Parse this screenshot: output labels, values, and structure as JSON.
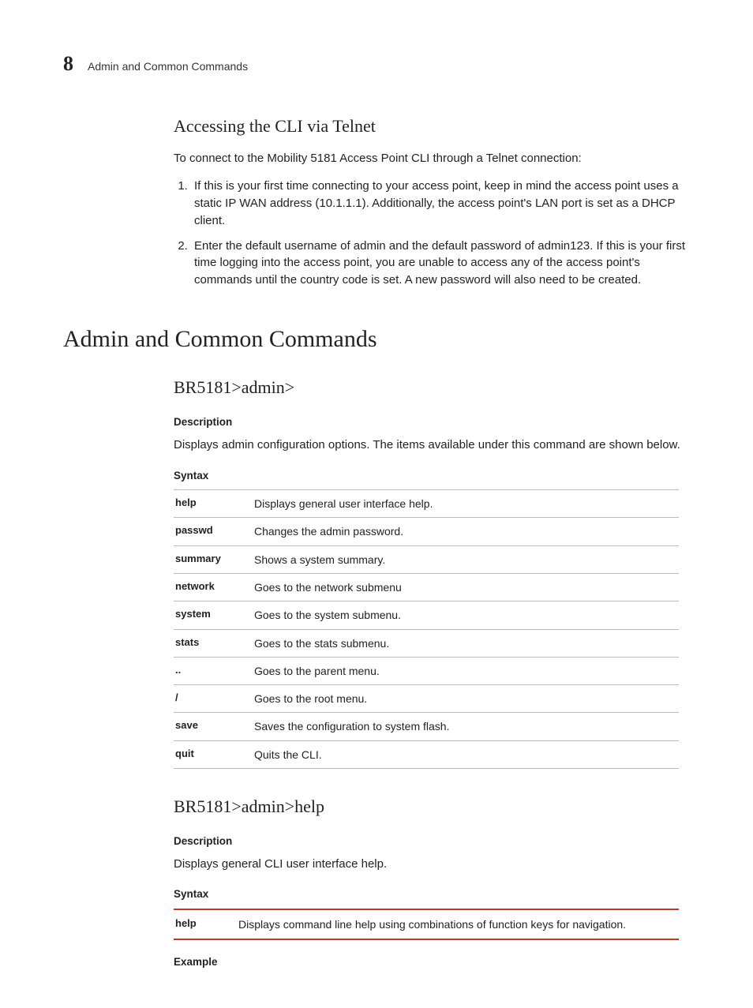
{
  "header": {
    "chapter_number": "8",
    "chapter_title": "Admin and Common Commands"
  },
  "section1": {
    "heading": "Accessing the CLI via Telnet",
    "intro": "To connect to the Mobility 5181 Access Point CLI through a Telnet connection:",
    "steps": [
      "If this is your first time connecting to your access point, keep in mind the access point uses a static IP WAN address (10.1.1.1). Additionally, the access point's LAN port is set as a DHCP client.",
      "Enter the default username of admin and the default password of admin123. If this is your first time logging into the access point, you are unable to access any of the access point's commands until the country code is set. A new password will also need to be created."
    ]
  },
  "h1": "Admin and Common Commands",
  "cmd1": {
    "heading": "BR5181>admin>",
    "desc_label": "Description",
    "desc_text": "Displays admin configuration options. The items available under this command are shown below.",
    "syntax_label": "Syntax",
    "rows": [
      {
        "cmd": "help",
        "desc": "Displays general user interface help."
      },
      {
        "cmd": "passwd",
        "desc": "Changes the admin password."
      },
      {
        "cmd": "summary",
        "desc": "Shows a system summary."
      },
      {
        "cmd": "network",
        "desc": "Goes to the network submenu"
      },
      {
        "cmd": "system",
        "desc": "Goes to the system submenu."
      },
      {
        "cmd": "stats",
        "desc": "Goes to the stats submenu."
      },
      {
        "cmd": "..",
        "desc": "Goes to the parent menu."
      },
      {
        "cmd": "/",
        "desc": "Goes to the root menu."
      },
      {
        "cmd": "save",
        "desc": "Saves the configuration to system flash."
      },
      {
        "cmd": "quit",
        "desc": "Quits the CLI."
      }
    ]
  },
  "cmd2": {
    "heading": "BR5181>admin>help",
    "desc_label": "Description",
    "desc_text": "Displays general CLI user interface help.",
    "syntax_label": "Syntax",
    "row": {
      "cmd": "help",
      "desc": "Displays command line help using combinations of function keys for navigation."
    },
    "example_label": "Example"
  }
}
